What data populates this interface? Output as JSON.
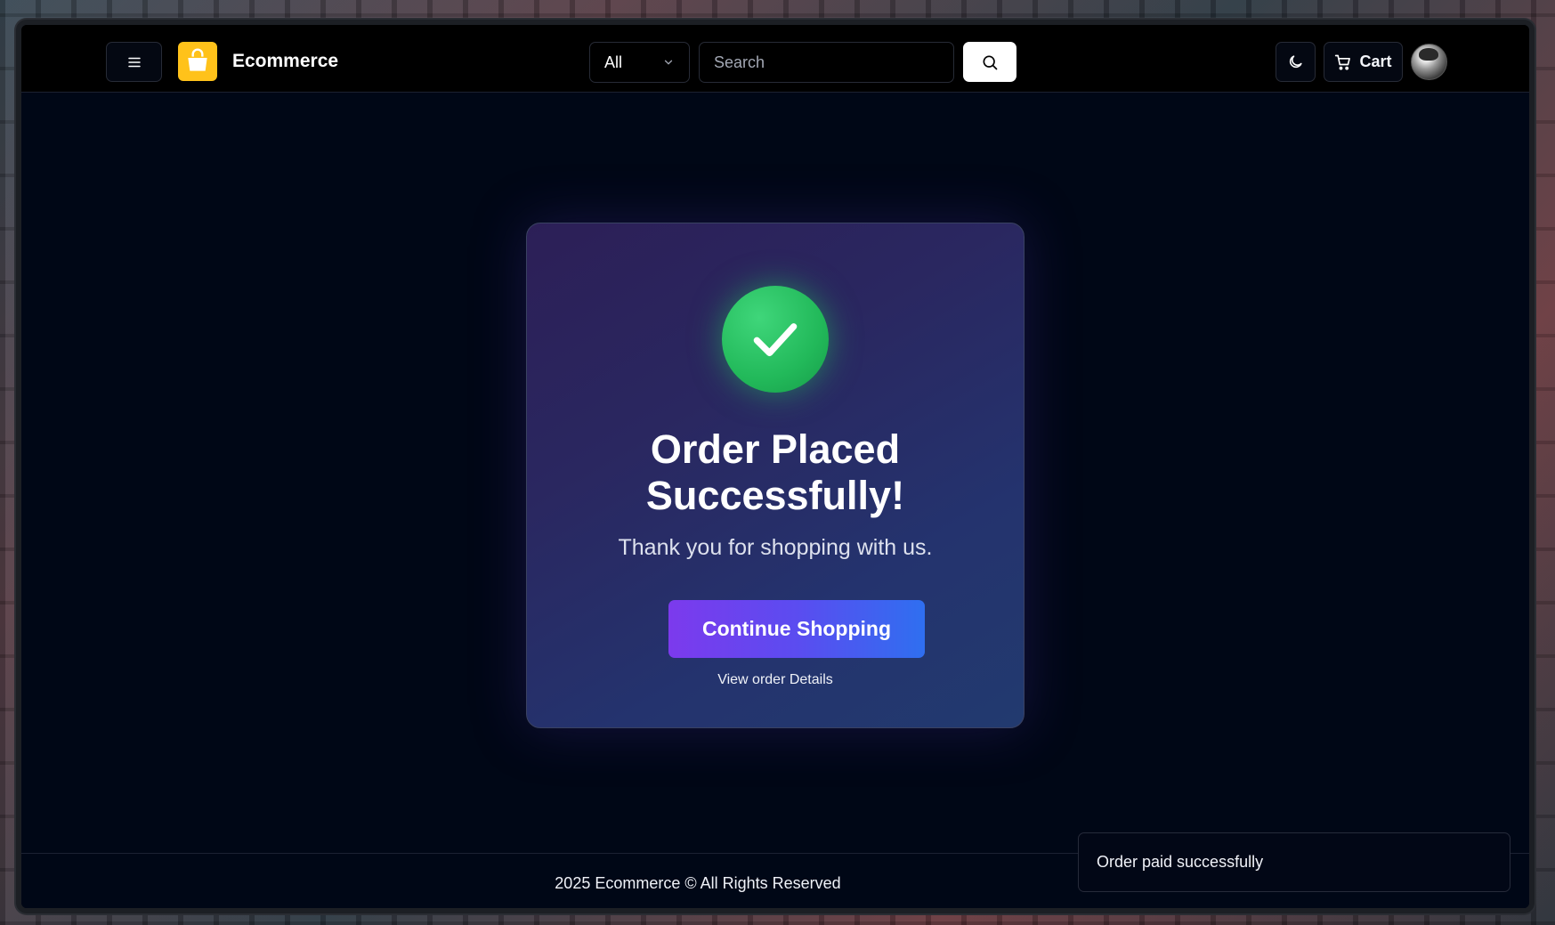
{
  "header": {
    "brand": "Ecommerce",
    "category_select": {
      "selected": "All"
    },
    "search": {
      "placeholder": "Search",
      "value": ""
    },
    "cart_label": "Cart"
  },
  "main": {
    "title": "Order Placed Successfully!",
    "subtitle": "Thank you for shopping with us.",
    "continue_label": "Continue Shopping",
    "view_order_label": "View order Details"
  },
  "footer": {
    "text": "2025 Ecommerce © All Rights Reserved"
  },
  "toast": {
    "message": "Order paid successfully"
  },
  "colors": {
    "accent_logo": "#ffc21a",
    "success": "#22c55e",
    "button_gradient_start": "#7c3aed",
    "button_gradient_end": "#2f6ff0",
    "background": "#000716"
  },
  "icons": {
    "menu": "menu-icon",
    "logo": "shopping-bag-icon",
    "dropdown": "chevron-down-icon",
    "search": "search-icon",
    "theme": "moon-icon",
    "cart": "cart-icon",
    "success": "check-icon"
  }
}
